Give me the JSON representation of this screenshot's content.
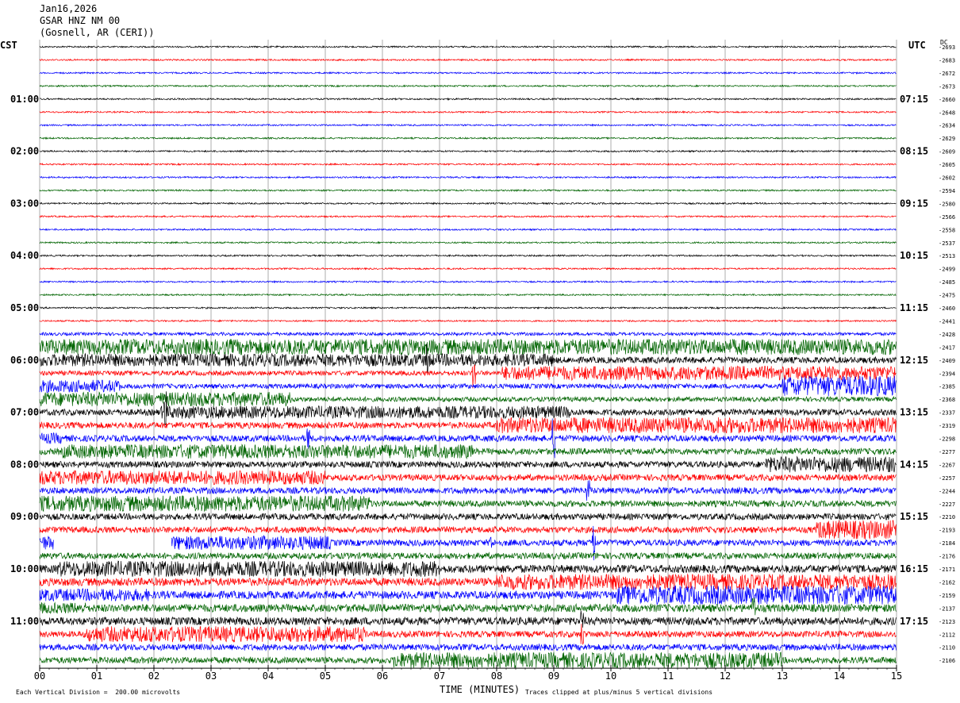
{
  "header": {
    "date": "Jan16,2026",
    "station": "GSAR HNZ NM 00",
    "location": "(Gosnell, AR (CERI))"
  },
  "left_zone": "CST",
  "right_zone": "UTC",
  "dc_label": "DC",
  "footer": {
    "xaxis_title": "TIME (MINUTES)",
    "scale_note": "Each Vertical Division =  200.00 microvolts",
    "clip_note": "Traces clipped at plus/minus 5 vertical divisions"
  },
  "colors": {
    "black": "#000000",
    "red": "#ff0000",
    "blue": "#0000ff",
    "green": "#006400",
    "grid": "#999999"
  },
  "chart_data": {
    "type": "line",
    "title": "GSAR HNZ NM 00",
    "xlabel": "TIME (MINUTES)",
    "xlim": [
      0,
      15
    ],
    "x_ticks": [
      "00",
      "01",
      "02",
      "03",
      "04",
      "05",
      "06",
      "07",
      "08",
      "09",
      "10",
      "11",
      "12",
      "13",
      "14",
      "15"
    ],
    "left_hour_labels": [
      "01:00",
      "02:00",
      "03:00",
      "04:00",
      "05:00",
      "06:00",
      "07:00",
      "08:00",
      "09:00",
      "10:00",
      "11:00"
    ],
    "right_hour_labels": [
      "07:15",
      "08:15",
      "09:15",
      "10:15",
      "11:15",
      "12:15",
      "13:15",
      "14:15",
      "15:15",
      "16:15",
      "17:15"
    ],
    "trace_colors": [
      "black",
      "red",
      "blue",
      "green"
    ],
    "dc_offsets": [
      -2693,
      -2683,
      -2672,
      -2673,
      -2660,
      -2648,
      -2634,
      -2629,
      -2609,
      -2605,
      -2602,
      -2594,
      -2580,
      -2566,
      -2558,
      -2537,
      -2513,
      -2499,
      -2485,
      -2475,
      -2460,
      -2441,
      -2428,
      -2417,
      -2409,
      -2394,
      -2385,
      -2368,
      -2337,
      -2319,
      -2298,
      -2277,
      -2267,
      -2257,
      -2244,
      -2227,
      -2210,
      -2193,
      -2184,
      -2176,
      -2171,
      -2162,
      -2159,
      -2137,
      -2123,
      -2112,
      -2110,
      -2106
    ],
    "trace_amplitude": [
      1,
      1,
      1,
      1,
      1,
      1,
      1,
      1,
      1,
      1,
      1,
      1,
      1,
      1,
      1,
      1,
      1,
      1,
      1,
      1,
      1,
      1,
      2,
      3,
      4,
      3,
      3,
      3,
      4,
      4,
      4,
      4,
      4,
      4,
      4,
      4,
      4,
      4,
      4,
      4,
      5,
      5,
      5,
      5,
      5,
      4,
      4,
      4
    ],
    "noise_bursts": [
      {
        "trace": 23,
        "start": 0.0,
        "end": 15.0,
        "level": 10
      },
      {
        "trace": 24,
        "start": 0.0,
        "end": 9.0,
        "level": 8
      },
      {
        "trace": 25,
        "start": 8.1,
        "end": 15.0,
        "level": 9
      },
      {
        "trace": 26,
        "start": 0.0,
        "end": 1.4,
        "level": 8
      },
      {
        "trace": 26,
        "start": 13.0,
        "end": 15.0,
        "level": 13
      },
      {
        "trace": 27,
        "start": 0.0,
        "end": 4.4,
        "level": 9
      },
      {
        "trace": 28,
        "start": 2.1,
        "end": 9.3,
        "level": 8
      },
      {
        "trace": 29,
        "start": 8.0,
        "end": 15.0,
        "level": 10
      },
      {
        "trace": 30,
        "start": 0.0,
        "end": 0.4,
        "level": 7
      },
      {
        "trace": 31,
        "start": 0.4,
        "end": 7.6,
        "level": 9
      },
      {
        "trace": 32,
        "start": 12.7,
        "end": 15.0,
        "level": 10
      },
      {
        "trace": 33,
        "start": 0.0,
        "end": 5.0,
        "level": 9
      },
      {
        "trace": 35,
        "start": 0.0,
        "end": 5.8,
        "level": 10
      },
      {
        "trace": 38,
        "start": 0.0,
        "end": 0.25,
        "level": 9
      },
      {
        "trace": 37,
        "start": 13.6,
        "end": 15.0,
        "level": 12
      },
      {
        "trace": 38,
        "start": 2.3,
        "end": 5.1,
        "level": 9
      },
      {
        "trace": 40,
        "start": 0.3,
        "end": 7.0,
        "level": 10
      },
      {
        "trace": 41,
        "start": 8.0,
        "end": 15.0,
        "level": 10
      },
      {
        "trace": 42,
        "start": 0.0,
        "end": 1.9,
        "level": 8
      },
      {
        "trace": 42,
        "start": 10.1,
        "end": 15.0,
        "level": 12
      },
      {
        "trace": 43,
        "start": 0.0,
        "end": 0.8,
        "level": 7
      },
      {
        "trace": 45,
        "start": 0.8,
        "end": 5.7,
        "level": 10
      },
      {
        "trace": 47,
        "start": 6.2,
        "end": 13.0,
        "level": 10
      }
    ],
    "gaps": [
      {
        "trace": 38,
        "start": 0.25,
        "end": 2.3
      }
    ],
    "spikes": [
      {
        "trace": 24,
        "x": 6.8,
        "level": 22
      },
      {
        "trace": 25,
        "x": 7.6,
        "level": 20
      },
      {
        "trace": 28,
        "x": 2.2,
        "level": 28
      },
      {
        "trace": 29,
        "x": 11.9,
        "level": 14
      },
      {
        "trace": 30,
        "x": 4.7,
        "level": 18
      },
      {
        "trace": 30,
        "x": 9.0,
        "level": 26
      },
      {
        "trace": 34,
        "x": 9.6,
        "level": 16
      },
      {
        "trace": 38,
        "x": 7.9,
        "level": 14
      },
      {
        "trace": 38,
        "x": 9.7,
        "level": 32
      },
      {
        "trace": 43,
        "x": 12.5,
        "level": 16
      },
      {
        "trace": 44,
        "x": 9.5,
        "level": 14
      },
      {
        "trace": 45,
        "x": 9.5,
        "level": 16
      }
    ]
  }
}
